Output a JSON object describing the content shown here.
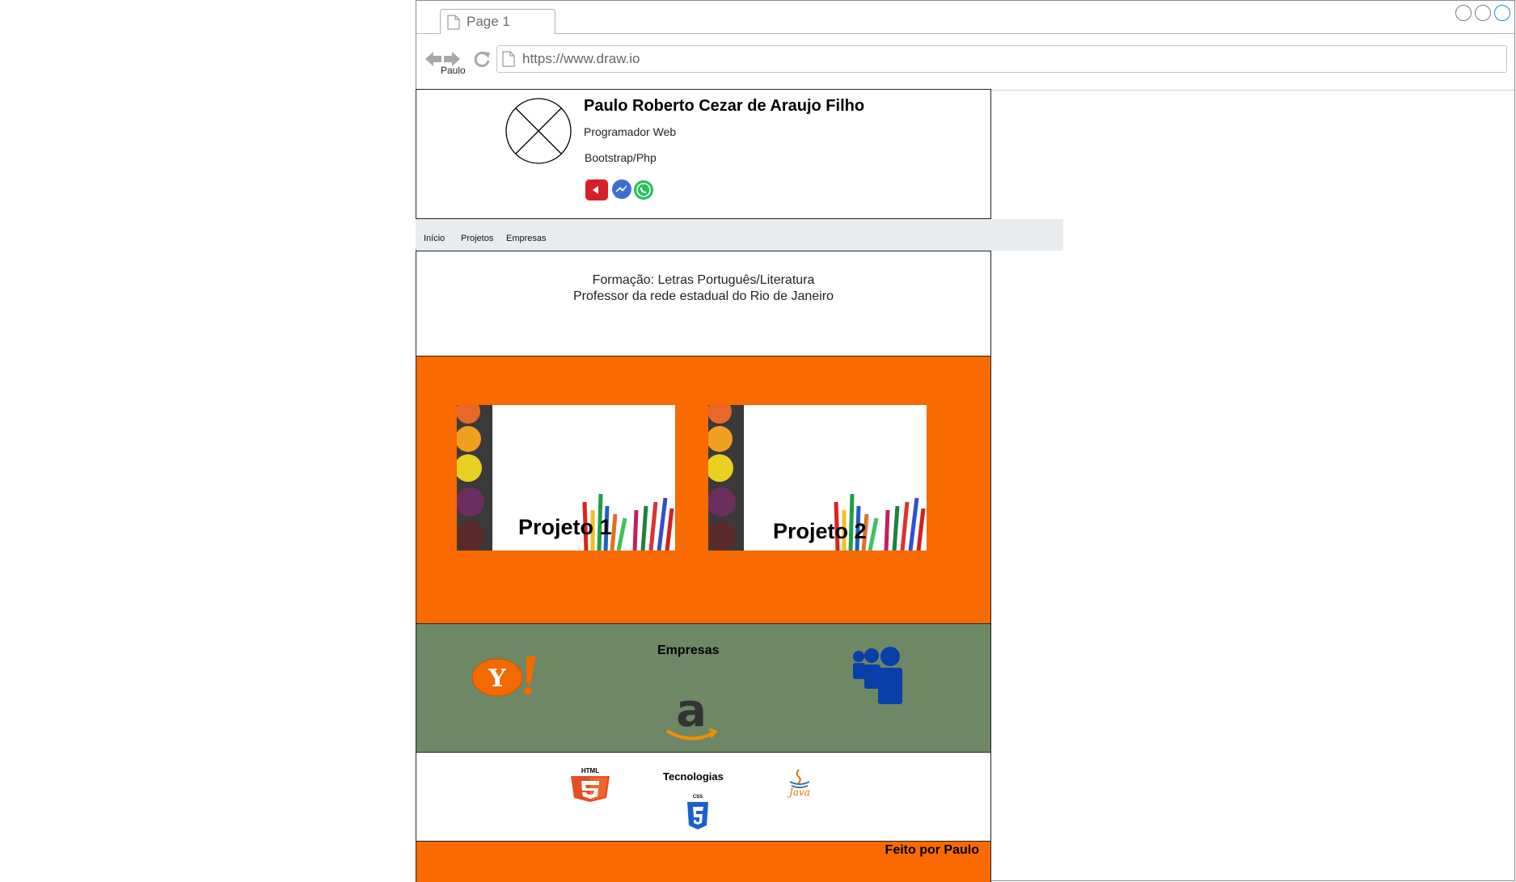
{
  "browser": {
    "tab_label": "Page 1",
    "url": "https://www.draw.io",
    "nav_label": "Paulo"
  },
  "profile": {
    "name": "Paulo Roberto Cezar de Araujo Filho",
    "role": "Programador Web",
    "stack": "Bootstrap/Php",
    "social_icons": [
      "youtube-icon",
      "messenger-icon",
      "whatsapp-icon"
    ]
  },
  "nav": {
    "items": [
      "Início",
      "Projetos",
      "Empresas"
    ]
  },
  "about": {
    "line1": "Formação: Letras Português/Literatura",
    "line2": "Professor da rede estadual do Rio de Janeiro"
  },
  "projects": {
    "items": [
      {
        "title": "Projeto 1"
      },
      {
        "title": "Projeto 2"
      }
    ]
  },
  "companies": {
    "title": "Empresas",
    "logos": [
      "yahoo-logo",
      "amazon-logo",
      "myspace-logo"
    ]
  },
  "tech": {
    "title": "Tecnologias",
    "logos": [
      "html5-logo",
      "css3-logo",
      "java-logo"
    ],
    "html5_label": "HTML",
    "css_label": "CSS",
    "java_label": "Java"
  },
  "footer": {
    "text": "Feito por Paulo"
  },
  "colors": {
    "orange": "#f96a00",
    "green": "#6e8765",
    "navbar": "#e9ecef"
  }
}
